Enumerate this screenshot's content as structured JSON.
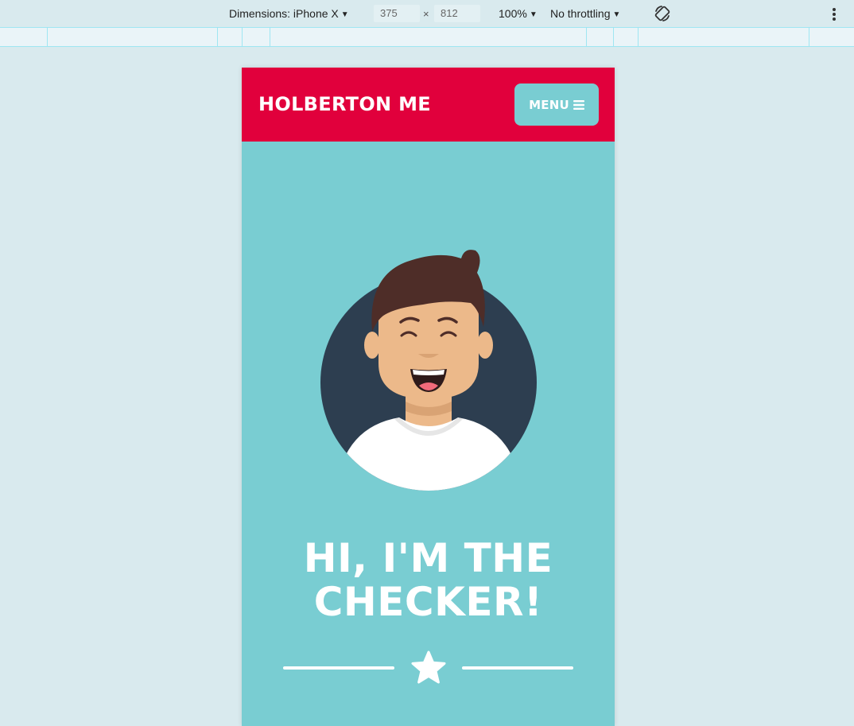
{
  "devtools": {
    "dimensions_label": "Dimensions: iPhone X",
    "width_value": "375",
    "height_value": "812",
    "times_sign": "×",
    "zoom": "100%",
    "throttling": "No throttling",
    "rotate_icon": "rotate-icon",
    "more_icon": "kebab-icon"
  },
  "site": {
    "brand": "HOLBERTON ME",
    "menu_label": "MENU",
    "menu_icon": "hamburger-icon",
    "hero_title_line1": "HI, I'M THE",
    "hero_title_line2": "CHECKER!",
    "divider_icon": "star-icon",
    "colors": {
      "header": "#e1003c",
      "body": "#79cdd2",
      "text": "#ffffff",
      "avatar_bg": "#2d3e50"
    }
  }
}
